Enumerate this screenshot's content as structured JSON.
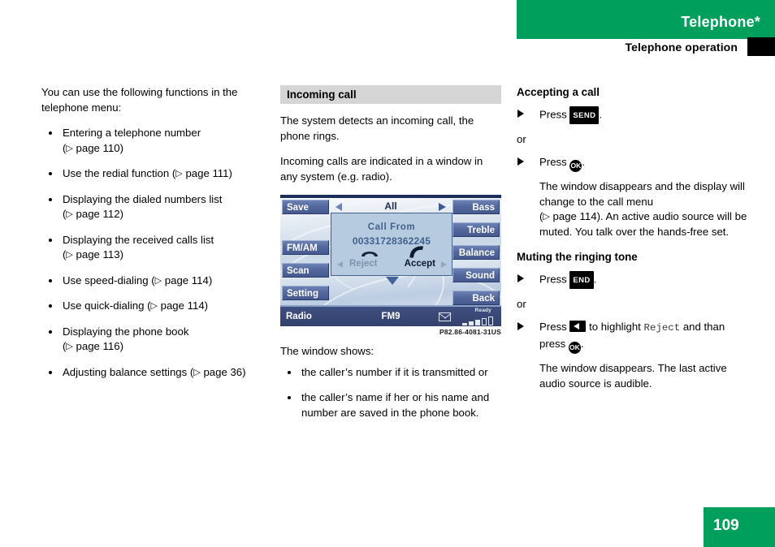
{
  "header": {
    "title": "Telephone*",
    "subtitle": "Telephone operation",
    "accent_color": "#00a05c"
  },
  "page_tab": {
    "number": "109",
    "color": "#00a05c"
  },
  "left_column": {
    "intro": "You can use the following functions in the telephone menu:",
    "bullets": [
      {
        "text": "Entering a telephone number",
        "ref": "( page 110)",
        "ref_page": "page 110",
        "break_before_ref": true
      },
      {
        "text": "Use the redial function",
        "ref": "( page 111)",
        "ref_page": "page 111",
        "break_before_ref": false
      },
      {
        "text": "Displaying the dialed numbers list",
        "ref": "( page 112)",
        "ref_page": "page 112",
        "break_before_ref": true
      },
      {
        "text": "Displaying the received calls list",
        "ref": "( page 113)",
        "ref_page": "page 113",
        "break_before_ref": true
      },
      {
        "text": "Use speed-dialing",
        "ref": "( page 114)",
        "ref_page": "page 114",
        "break_before_ref": false
      },
      {
        "text": "Use quick-dialing",
        "ref": "( page 114)",
        "ref_page": "page 114",
        "break_before_ref": false
      },
      {
        "text": "Displaying the phone book",
        "ref": "( page 116)",
        "ref_page": "page 116",
        "break_before_ref": true
      },
      {
        "text": "Adjusting balance settings",
        "ref": "( page 36)",
        "ref_page": "page 36",
        "break_before_ref": false
      }
    ]
  },
  "middle_column": {
    "section_heading": "Incoming call",
    "paragraph1": "The system detects an incoming call, the phone rings.",
    "paragraph2": "Incoming calls are indicated in a window in any system (e.g. radio).",
    "after_figure_lead": "The window shows:",
    "after_figure_bullets": [
      "the caller’s number if it is transmitted or",
      "the caller’s name if her or his name and number are saved in the phone book."
    ],
    "figure": {
      "caption": "P82.86-4081-31US",
      "left_buttons": [
        "Save",
        "FM/AM",
        "Scan",
        "Setting"
      ],
      "right_buttons": [
        "Bass",
        "Treble",
        "Balance",
        "Sound",
        "Back"
      ],
      "nav_label": "All",
      "popup": {
        "title": "Call From",
        "number": "00331728362245",
        "reject_label": "Reject",
        "accept_label": "Accept",
        "hangup_icon": "hangup-handset-icon",
        "pickup_icon": "pickup-handset-icon"
      },
      "status_bar": {
        "source": "Radio",
        "band": "FM9",
        "message_icon": "envelope-icon",
        "ready_label": "Ready",
        "signal_bars_filled": 3,
        "signal_bars_total": 5
      }
    }
  },
  "right_column": {
    "section1_heading": "Accepting a call",
    "step1_prefix": "Press",
    "step1_key": "SEND",
    "step1_suffix": ".",
    "or_label": "or",
    "step2_prefix": "Press",
    "step2_key": "OK",
    "step2_suffix": ".",
    "step2_detail_a": "The window disappears and the display will change to the call menu",
    "step2_detail_ref": "( page 114).",
    "step2_detail_b": " An active audio source will be muted. You talk over the hands-free set.",
    "section2_heading": "Muting the ringing tone",
    "step3_prefix": "Press",
    "step3_key": "END",
    "step3_suffix": ".",
    "step4_prefix": "Press",
    "step4_key": "left-arrow-key",
    "step4_mid": "to highlight",
    "step4_term": "Reject",
    "step4_after": "and than press",
    "step4_key2": "OK",
    "step4_suffix": ".",
    "step4_detail": "The window disappears. The last active audio source is audible."
  }
}
